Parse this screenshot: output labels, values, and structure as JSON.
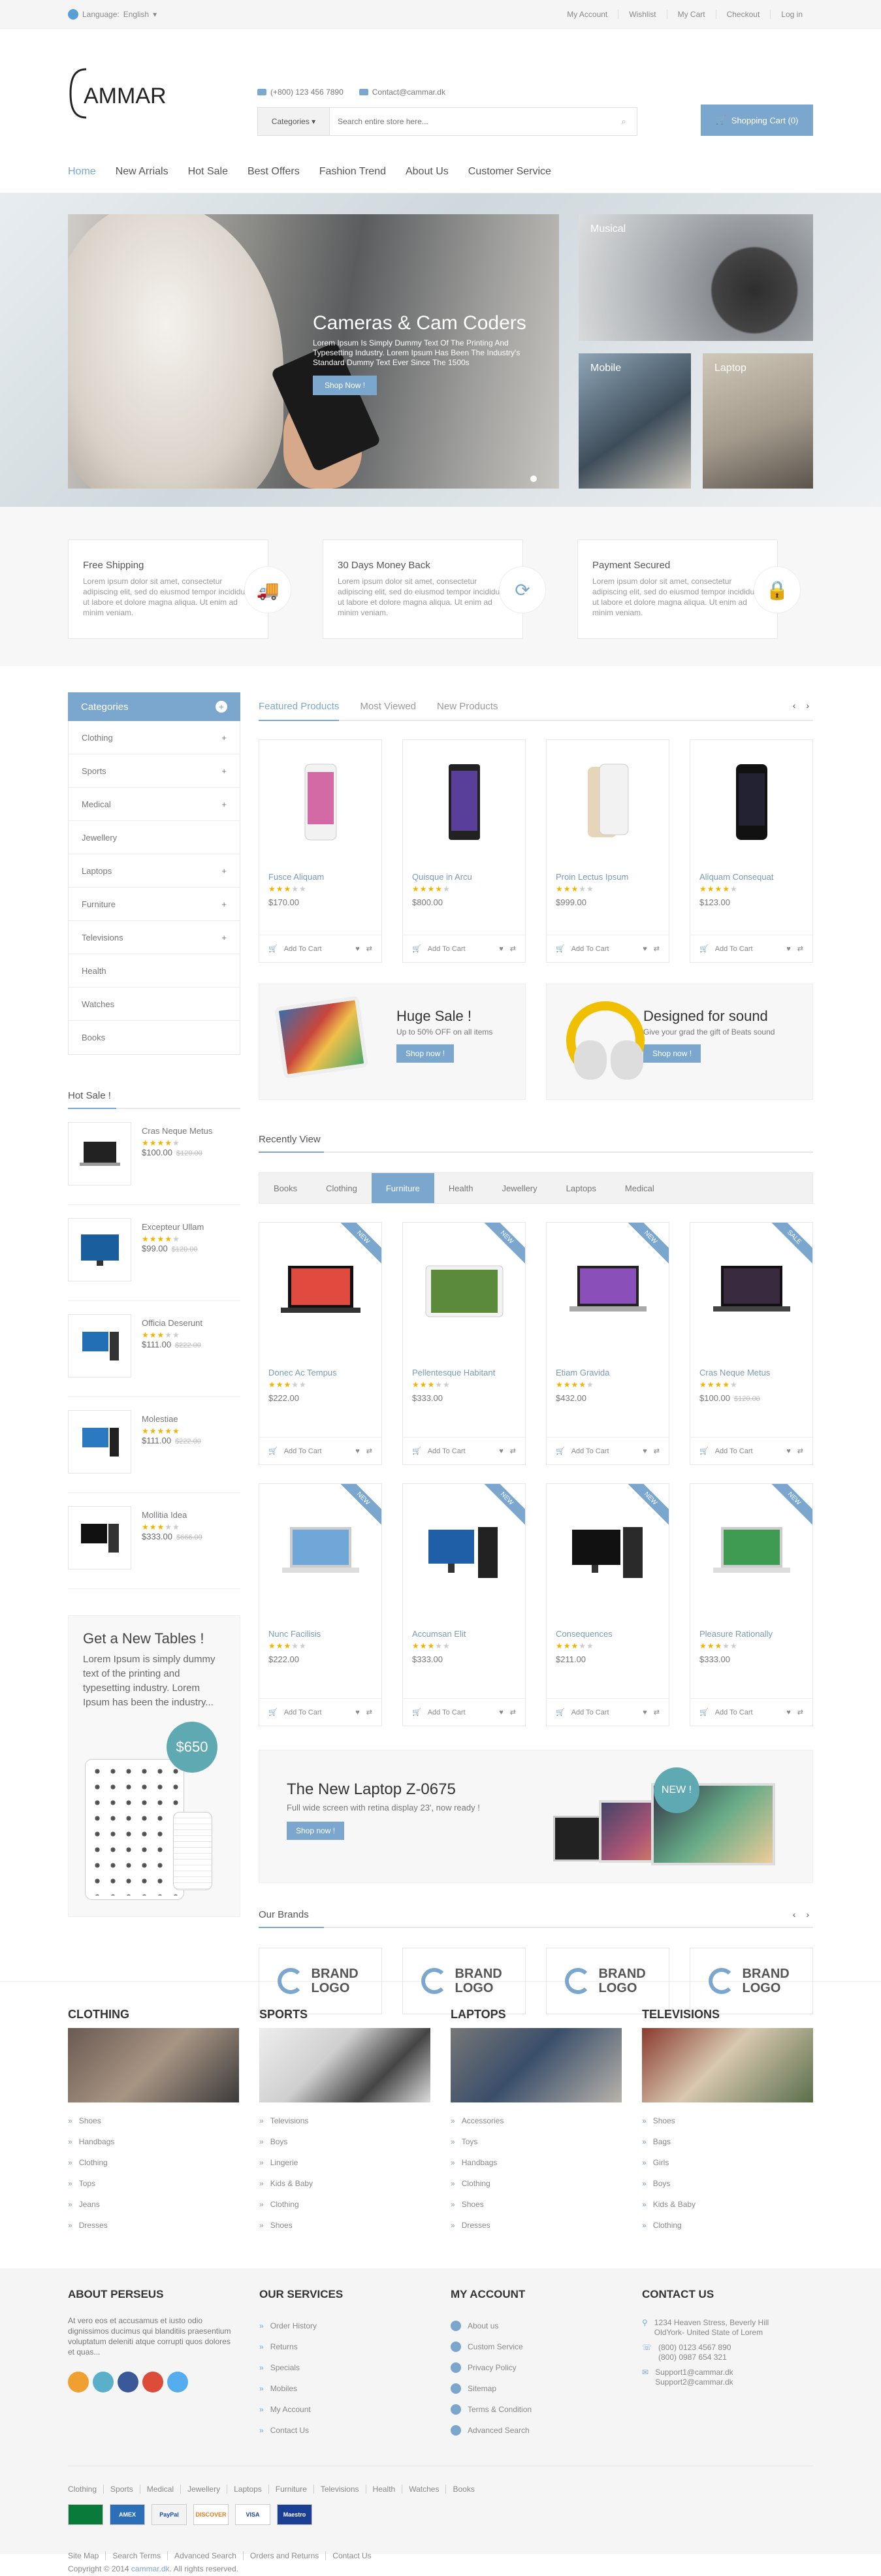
{
  "topbar": {
    "language_label": "Language:",
    "language_value": "English",
    "links": [
      "My Account",
      "Wishlist",
      "My Cart",
      "Checkout",
      "Log in"
    ]
  },
  "header": {
    "phone": "(+800) 123 456 7890",
    "email": "Contact@cammar.dk",
    "search_category": "Categories",
    "search_placeholder": "Search entire store here...",
    "cart_label": "Shopping Cart (0)"
  },
  "nav": [
    "Home",
    "New Arrials",
    "Hot Sale",
    "Best Offers",
    "Fashion Trend",
    "About Us",
    "Customer Service"
  ],
  "hero": {
    "title": "Cameras & Cam Coders",
    "text": "Lorem Ipsum Is Simply Dummy Text Of The Printing And Typesetting Industry. Lorem Ipsum Has Been The Industry's Standard Dummy Text Ever Since The 1500s",
    "button": "Shop Now !",
    "tiles": [
      "Musical",
      "Mobile",
      "Laptop"
    ]
  },
  "features": [
    {
      "title": "Free Shipping",
      "text": "Lorem ipsum dolor sit amet, consectetur adipiscing elit, sed do eiusmod tempor incididunt ut labore et dolore magna aliqua. Ut enim ad minim veniam."
    },
    {
      "title": "30 Days Money Back",
      "text": "Lorem ipsum dolor sit amet, consectetur adipiscing elit, sed do eiusmod tempor incididunt ut labore et dolore magna aliqua. Ut enim ad minim veniam."
    },
    {
      "title": "Payment Secured",
      "text": "Lorem ipsum dolor sit amet, consectetur adipiscing elit, sed do eiusmod tempor incididunt ut labore et dolore magna aliqua. Ut enim ad minim veniam."
    }
  ],
  "sidebar": {
    "title": "Categories",
    "items": [
      "Clothing",
      "Sports",
      "Medical",
      "Jewellery",
      "Laptops",
      "Furniture",
      "Televisions",
      "Health",
      "Watches",
      "Books"
    ],
    "hot_sale_title": "Hot Sale !",
    "hot_items": [
      {
        "name": "Cras Neque Metus",
        "price": "$100.00",
        "old": "$120.00"
      },
      {
        "name": "Excepteur Ullam",
        "price": "$99.00",
        "old": "$120.00"
      },
      {
        "name": "Officia Deserunt",
        "price": "$111.00",
        "old": "$222.00"
      },
      {
        "name": "Molestiae",
        "price": "$111.00",
        "old": "$222.00"
      },
      {
        "name": "Mollitia Idea",
        "price": "$333.00",
        "old": "$666.00"
      }
    ],
    "promo_title": "Get a New Tables !",
    "promo_text": "Lorem Ipsum is simply dummy text of the printing and typesetting industry. Lorem Ipsum has been the industry...",
    "promo_price": "$650"
  },
  "featured": {
    "tabs": [
      "Featured Products",
      "Most Viewed",
      "New Products"
    ],
    "arrows": "‹ ›",
    "add_label": "Add To Cart",
    "products": [
      {
        "name": "Fusce Aliquam",
        "price": "$170.00"
      },
      {
        "name": "Quisque in Arcu",
        "price": "$800.00"
      },
      {
        "name": "Proin Lectus Ipsum",
        "price": "$999.00"
      },
      {
        "name": "Aliquam Consequat",
        "price": "$123.00"
      }
    ]
  },
  "banners": [
    {
      "title": "Huge Sale !",
      "text": "Up to 50% OFF on all items",
      "button": "Shop now !"
    },
    {
      "title": "Designed for sound",
      "text": "Give your grad the gift of Beats sound",
      "button": "Shop now !"
    }
  ],
  "recent": {
    "title": "Recently View",
    "filters": [
      "Books",
      "Clothing",
      "Furniture",
      "Health",
      "Jewellery",
      "Laptops",
      "Medical"
    ],
    "products": [
      {
        "name": "Donec Ac Tempus",
        "price": "$222.00",
        "old": "",
        "tag": "NEW"
      },
      {
        "name": "Pellentesque Habitant",
        "price": "$333.00",
        "old": "",
        "tag": "NEW"
      },
      {
        "name": "Etiam Gravida",
        "price": "$432.00",
        "old": "",
        "tag": "NEW"
      },
      {
        "name": "Cras Neque Metus",
        "price": "$100.00",
        "old": "$120.00",
        "tag": "SALE"
      },
      {
        "name": "Nunc Facilisis",
        "price": "$222.00",
        "old": "",
        "tag": "NEW"
      },
      {
        "name": "Accumsan Elit",
        "price": "$333.00",
        "old": "",
        "tag": "NEW"
      },
      {
        "name": "Consequences",
        "price": "$211.00",
        "old": "",
        "tag": "NEW"
      },
      {
        "name": "Pleasure Rationally",
        "price": "$333.00",
        "old": "",
        "tag": "NEW"
      }
    ]
  },
  "laptop_banner": {
    "title": "The New Laptop Z-0675",
    "text": "Full wide screen with retina display 23', now ready !",
    "button": "Shop now !",
    "badge": "NEW !"
  },
  "brands": {
    "title": "Our Brands",
    "label": "BRAND LOGO",
    "count": 4
  },
  "footer_categories": [
    {
      "title": "CLOTHING",
      "items": [
        "Shoes",
        "Handbags",
        "Clothing",
        "Tops",
        "Jeans",
        "Dresses"
      ]
    },
    {
      "title": "SPORTS",
      "items": [
        "Televisions",
        "Boys",
        "Lingerie",
        "Kids & Baby",
        "Clothing",
        "Shoes"
      ]
    },
    {
      "title": "LAPTOPS",
      "items": [
        "Accessories",
        "Toys",
        "Handbags",
        "Clothing",
        "Shoes",
        "Dresses"
      ]
    },
    {
      "title": "TELEVISIONS",
      "items": [
        "Shoes",
        "Bags",
        "Girls",
        "Boys",
        "Kids & Baby",
        "Clothing"
      ]
    }
  ],
  "footer": {
    "about_title": "ABOUT PERSEUS",
    "about_text": "At vero eos et accusamus et iusto odio dignissimos ducimus qui blanditiis praesentium voluptatum deleniti atque corrupti quos dolores et quas...",
    "services_title": "OUR SERVICES",
    "services": [
      "Order History",
      "Returns",
      "Specials",
      "Mobiles",
      "My Account",
      "Contact Us"
    ],
    "account_title": "MY ACCOUNT",
    "account": [
      "About us",
      "Custom Service",
      "Privacy Policy",
      "Sitemap",
      "Terms & Condition",
      "Advanced Search"
    ],
    "contact_title": "CONTACT US",
    "address": "1234 Heaven Stress, Beverly Hill OldYork- United State of Lorem",
    "phone1": "(800) 0123 4567 890",
    "phone2": "(800) 0987 654 321",
    "mail1": "Support1@cammar.dk",
    "mail2": "Support2@cammar.dk",
    "bottom_links": [
      "Clothing",
      "Sports",
      "Medical",
      "Jewellery",
      "Laptops",
      "Furniture",
      "Televisions",
      "Health",
      "Watches",
      "Books"
    ],
    "payments": [
      "",
      "AMEX",
      "PayPal",
      "DISCOVER",
      "VISA",
      "Maestro"
    ],
    "copy_links": [
      "Site Map",
      "Search Terms",
      "Advanced Search",
      "Orders and Returns",
      "Contact Us"
    ],
    "copyright_pre": "Copyright © 2014",
    "copyright_site": "cammar.dk",
    "copyright_post": ". All rights reserved."
  }
}
